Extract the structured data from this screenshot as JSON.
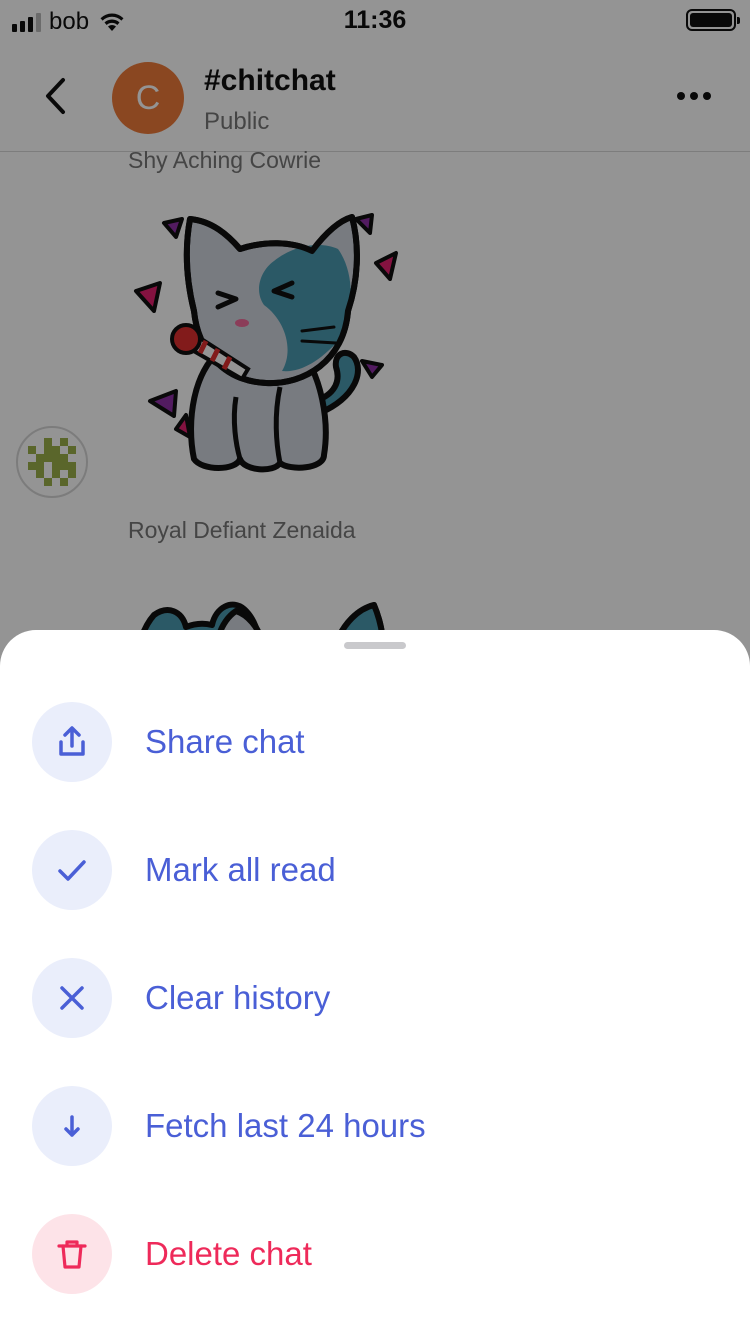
{
  "status_bar": {
    "carrier": "bob",
    "time": "11:36"
  },
  "header": {
    "avatar_letter": "C",
    "avatar_color": "#ee7a39",
    "title": "#chitchat",
    "subtitle": "Public",
    "back_icon": "chevron-left-icon",
    "more_icon": "more-horizontal-icon"
  },
  "messages": [
    {
      "sender": "Shy Aching Cowrie",
      "content": "cat-party-sticker"
    },
    {
      "sender": "Royal Defiant Zenaida",
      "content": "cat-sticker"
    }
  ],
  "sheet": {
    "items": [
      {
        "label": "Share chat",
        "icon": "share-icon",
        "style": "default"
      },
      {
        "label": "Mark all read",
        "icon": "check-icon",
        "style": "default"
      },
      {
        "label": "Clear history",
        "icon": "close-icon",
        "style": "default"
      },
      {
        "label": "Fetch last 24 hours",
        "icon": "arrow-down-icon",
        "style": "default"
      },
      {
        "label": "Delete chat",
        "icon": "trash-icon",
        "style": "danger"
      }
    ]
  },
  "colors": {
    "accent": "#4a5fd6",
    "accent_bg": "#eaeefb",
    "danger": "#ee2a5a",
    "danger_bg": "#fde3e8"
  }
}
